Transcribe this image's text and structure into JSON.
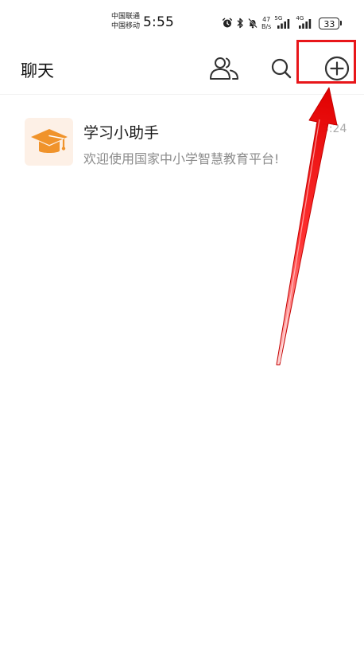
{
  "status_bar": {
    "carrier_1": "中国联通",
    "carrier_2": "中国移动",
    "time": "5:55",
    "net_speed_value": "47",
    "net_speed_unit": "B/s",
    "signal_1_label": "5G",
    "signal_2_label": "4G",
    "battery_level": "33"
  },
  "header": {
    "title": "聊天",
    "icons": [
      "contacts-icon",
      "search-icon",
      "add-icon"
    ]
  },
  "chats": [
    {
      "name": "学习小助手",
      "preview": "欢迎使用国家中小学智慧教育平台!",
      "time": "13:24",
      "avatar_icon": "graduation-cap-icon"
    }
  ],
  "annotation": {
    "color": "#e8161a",
    "target": "add-button"
  },
  "colors": {
    "avatar_bg": "#fdf0e6",
    "avatar_icon": "#f0932b",
    "preview_text": "#8c8c8c"
  }
}
